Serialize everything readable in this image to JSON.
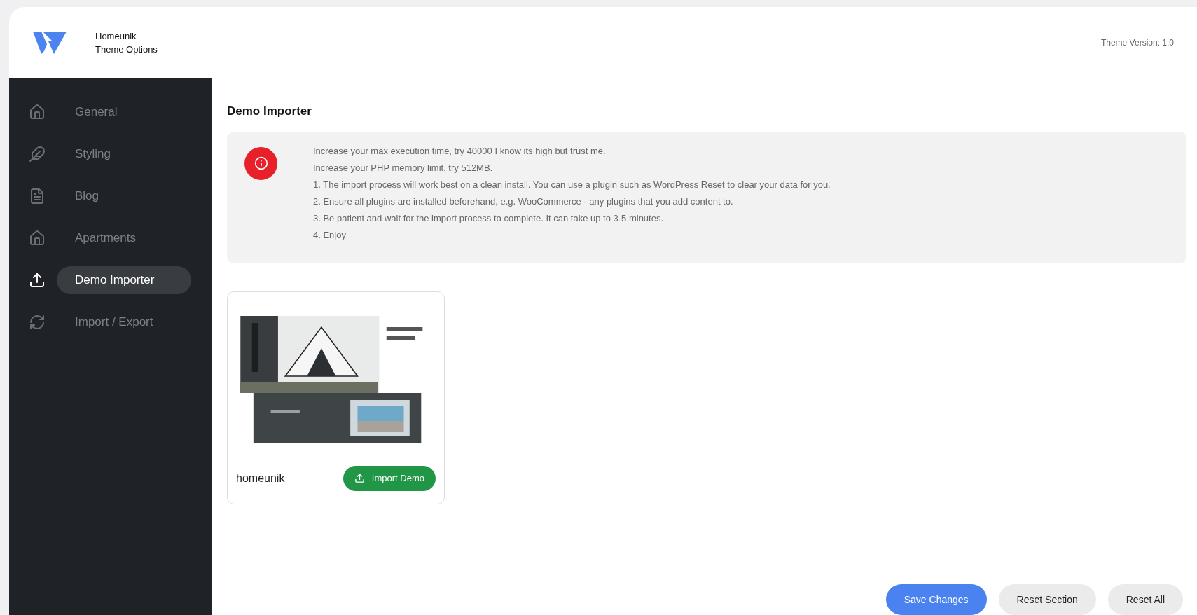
{
  "header": {
    "brand": "Homeunik",
    "subtitle": "Theme Options",
    "version": "Theme Version: 1.0"
  },
  "sidebar": {
    "items": [
      {
        "label": "General",
        "kind": "home",
        "selected": false
      },
      {
        "label": "Styling",
        "kind": "feather",
        "selected": false
      },
      {
        "label": "Blog",
        "kind": "document",
        "selected": false
      },
      {
        "label": "Apartments",
        "kind": "house",
        "selected": false
      },
      {
        "label": "Demo Importer",
        "kind": "upload",
        "selected": true
      },
      {
        "label": "Import / Export",
        "kind": "sync",
        "selected": false
      }
    ]
  },
  "section_title": "Demo Importer",
  "notice": {
    "lines": [
      "Increase your max execution time, try 40000 I know its high but trust me.",
      "Increase your PHP memory limit, try 512MB.",
      "1. The import process will work best on a clean install. You can use a plugin such as WordPress Reset to clear your data for you.",
      "2. Ensure all plugins are installed beforehand, e.g. WooCommerce - any plugins that you add content to.",
      "3. Be patient and wait for the import process to complete. It can take up to 3-5 minutes.",
      "4. Enjoy"
    ]
  },
  "demos": [
    {
      "name": "homeunik",
      "button": "Import Demo"
    }
  ],
  "footer": {
    "buttons": [
      {
        "label": "Save Changes",
        "kind": "primary"
      },
      {
        "label": "Reset Section",
        "kind": "secondary"
      },
      {
        "label": "Reset All",
        "kind": "secondary"
      }
    ]
  }
}
